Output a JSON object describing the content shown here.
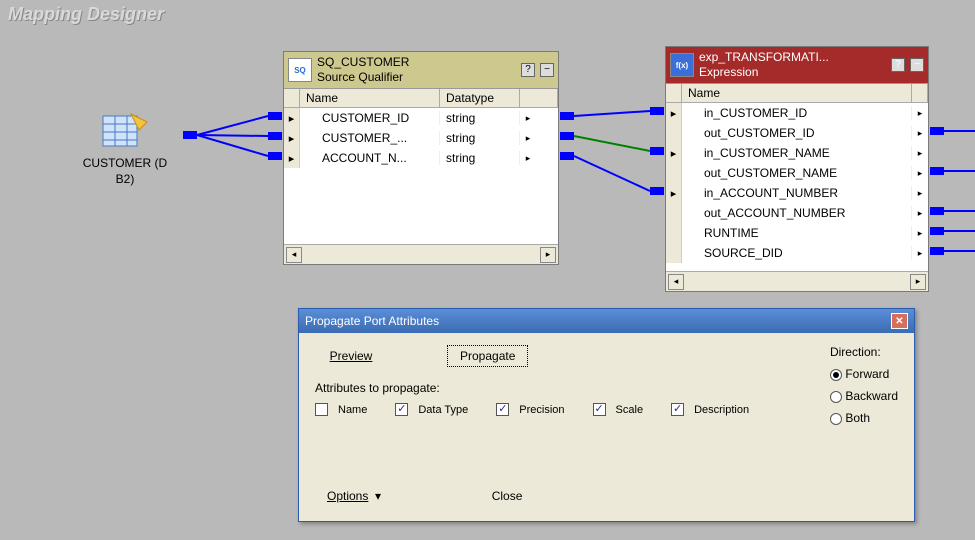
{
  "designer_title": "Mapping Designer",
  "source": {
    "label1": "CUSTOMER (D",
    "label2": "B2)"
  },
  "sq": {
    "title": "SQ_CUSTOMER",
    "subtitle": "Source Qualifier",
    "headers": {
      "name": "Name",
      "datatype": "Datatype"
    },
    "rows": [
      {
        "name": "CUSTOMER_ID",
        "datatype": "string"
      },
      {
        "name": "CUSTOMER_...",
        "datatype": "string"
      },
      {
        "name": "ACCOUNT_N...",
        "datatype": "string"
      }
    ]
  },
  "exp": {
    "title": "exp_TRANSFORMATI...",
    "subtitle": "Expression",
    "headers": {
      "name": "Name"
    },
    "rows": [
      {
        "name": "in_CUSTOMER_ID"
      },
      {
        "name": "out_CUSTOMER_ID"
      },
      {
        "name": "in_CUSTOMER_NAME"
      },
      {
        "name": "out_CUSTOMER_NAME"
      },
      {
        "name": "in_ACCOUNT_NUMBER"
      },
      {
        "name": "out_ACCOUNT_NUMBER"
      },
      {
        "name": "RUNTIME"
      },
      {
        "name": "SOURCE_DID"
      }
    ]
  },
  "dialog": {
    "title": "Propagate Port Attributes",
    "preview": "Preview",
    "propagate": "Propagate",
    "attributes_label": "Attributes to propagate:",
    "attrs": {
      "name": "Name",
      "datatype": "Data Type",
      "precision": "Precision",
      "scale": "Scale",
      "description": "Description"
    },
    "attr_checked": {
      "name": false,
      "datatype": true,
      "precision": true,
      "scale": true,
      "description": true
    },
    "direction": {
      "label": "Direction:",
      "forward": "Forward",
      "backward": "Backward",
      "both": "Both",
      "selected": "forward"
    },
    "options": "Options",
    "close": "Close"
  },
  "colors": {
    "blue_link": "#0000ff",
    "green_link": "#008000"
  }
}
